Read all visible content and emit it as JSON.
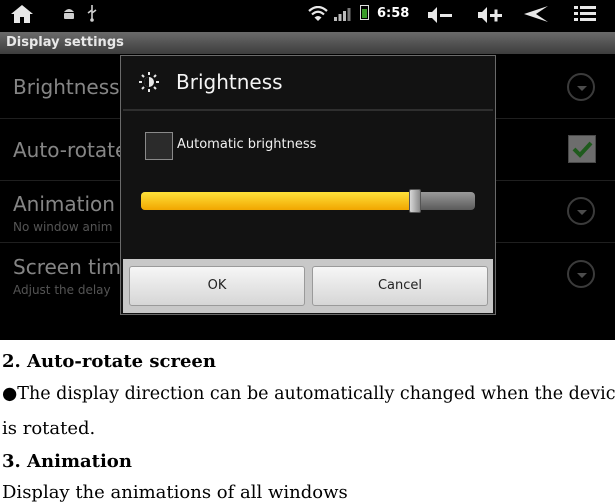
{
  "status_bar": {
    "clock": "6:58",
    "icons": [
      "home-icon",
      "android-debug-icon",
      "usb-icon",
      "wifi-icon",
      "signal-icon",
      "battery-icon",
      "volume-down-icon",
      "volume-up-icon",
      "back-icon",
      "menu-icon"
    ]
  },
  "screen_title": "Display settings",
  "settings": [
    {
      "title": "Brightness",
      "subtitle": "",
      "control": "chevron"
    },
    {
      "title": "Auto-rotate",
      "subtitle": "",
      "control": "checkbox"
    },
    {
      "title": "Animation",
      "subtitle": "No window anim",
      "control": "chevron"
    },
    {
      "title": "Screen tim",
      "subtitle": "Adjust the delay",
      "control": "chevron"
    }
  ],
  "dialog": {
    "title": "Brightness",
    "icon": "brightness-icon",
    "auto_label": "Automatic brightness",
    "auto_checked": false,
    "level_fraction": 0.82,
    "ok_label": "OK",
    "cancel_label": "Cancel"
  },
  "colors": {
    "slider_fill": "#f5c000",
    "check_green": "#3aa635"
  },
  "document": {
    "heading1": "2. Auto-rotate screen",
    "para1_line1": "●The display direction can be automatically changed when the device",
    "para1_line2": "is rotated.",
    "heading2": "3. Animation",
    "para2": "Display the animations of all windows"
  }
}
